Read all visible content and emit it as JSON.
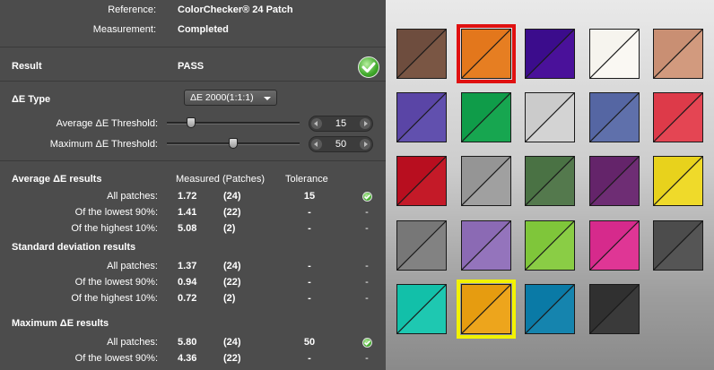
{
  "header": {
    "reference_label": "Reference:",
    "reference_value": "ColorChecker® 24 Patch",
    "measurement_label": "Measurement:",
    "measurement_value": "Completed"
  },
  "result": {
    "label": "Result",
    "value": "PASS",
    "icon": "check-circle-icon"
  },
  "delta_e": {
    "label": "ΔE Type",
    "selected": "ΔE 2000(1:1:1)",
    "avg_threshold_label": "Average  ΔE Threshold:",
    "avg_threshold_value": "15",
    "avg_threshold_level": 0.18,
    "max_threshold_label": "Maximum ΔE Threshold:",
    "max_threshold_value": "50",
    "max_threshold_level": 0.5
  },
  "columns": {
    "measured": "Measured (Patches)",
    "tolerance": "Tolerance"
  },
  "sections": [
    {
      "title": "Average ΔE results",
      "rows": [
        {
          "label": "All patches:",
          "measured": "1.72",
          "patches": "(24)",
          "tolerance": "15",
          "status": "check"
        },
        {
          "label": "Of the lowest 90%:",
          "measured": "1.41",
          "patches": "(22)",
          "tolerance": "-",
          "status": "-"
        },
        {
          "label": "Of the highest 10%:",
          "measured": "5.08",
          "patches": "(2)",
          "tolerance": "-",
          "status": "-"
        }
      ]
    },
    {
      "title": "Standard deviation results",
      "rows": [
        {
          "label": "All patches:",
          "measured": "1.37",
          "patches": "(24)",
          "tolerance": "-",
          "status": "-"
        },
        {
          "label": "Of the lowest 90%:",
          "measured": "0.94",
          "patches": "(22)",
          "tolerance": "-",
          "status": "-"
        },
        {
          "label": "Of the highest 10%:",
          "measured": "0.72",
          "patches": "(2)",
          "tolerance": "-",
          "status": "-"
        }
      ]
    },
    {
      "title": "Maximum ΔE results",
      "rows": [
        {
          "label": "All patches:",
          "measured": "5.80",
          "patches": "(24)",
          "tolerance": "50",
          "status": "check"
        },
        {
          "label": "Of the lowest 90%:",
          "measured": "4.36",
          "patches": "(22)",
          "tolerance": "-",
          "status": "-"
        }
      ]
    }
  ],
  "patches": [
    {
      "a": "#6e4d3e",
      "b": "#7a5644"
    },
    {
      "a": "#e3771c",
      "b": "#e67e22",
      "highlight": "#e01010"
    },
    {
      "a": "#3b0c8c",
      "b": "#4a119a"
    },
    {
      "a": "#f6f4ee",
      "b": "#faf8f3"
    },
    {
      "a": "#c98f73",
      "b": "#d29a7e"
    },
    {
      "a": "#5a45a6",
      "b": "#6150ae"
    },
    {
      "a": "#0f9c49",
      "b": "#17a650"
    },
    {
      "a": "#cbcbcb",
      "b": "#d3d3d3"
    },
    {
      "a": "#5566a3",
      "b": "#5f70ab"
    },
    {
      "a": "#dd3a49",
      "b": "#e44553"
    },
    {
      "a": "#b80e1f",
      "b": "#c41a28"
    },
    {
      "a": "#959595",
      "b": "#a0a0a0"
    },
    {
      "a": "#4a7244",
      "b": "#54794d"
    },
    {
      "a": "#64246a",
      "b": "#6e2d74"
    },
    {
      "a": "#e8d21c",
      "b": "#efda2a"
    },
    {
      "a": "#777777",
      "b": "#828282"
    },
    {
      "a": "#8b6ab4",
      "b": "#9474bc"
    },
    {
      "a": "#7fc63a",
      "b": "#8acd45"
    },
    {
      "a": "#d62a8c",
      "b": "#df3695"
    },
    {
      "a": "#4c4c4c",
      "b": "#555555"
    },
    {
      "a": "#12c0a9",
      "b": "#1ec8b1"
    },
    {
      "a": "#e69c10",
      "b": "#eda51c",
      "highlight": "#f2f200"
    },
    {
      "a": "#0a7aa6",
      "b": "#1584ae"
    },
    {
      "a": "#303030",
      "b": "#3a3a3a"
    }
  ]
}
